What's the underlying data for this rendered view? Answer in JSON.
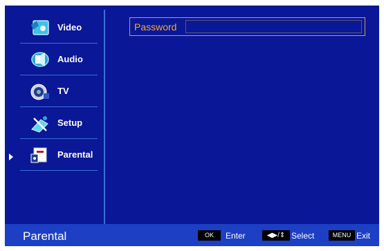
{
  "sidebar": {
    "items": [
      {
        "label": "Video",
        "icon": "video-icon"
      },
      {
        "label": "Audio",
        "icon": "audio-icon"
      },
      {
        "label": "TV",
        "icon": "tv-icon"
      },
      {
        "label": "Setup",
        "icon": "setup-icon"
      },
      {
        "label": "Parental",
        "icon": "parental-icon",
        "selected": true
      }
    ]
  },
  "main": {
    "password_label": "Password",
    "password_value": ""
  },
  "footer": {
    "title": "Parental",
    "hints": [
      {
        "key": "OK",
        "label": "Enter"
      },
      {
        "key": "◀▶/⇕",
        "label": "Select"
      },
      {
        "key": "MENU",
        "label": "Exit"
      }
    ]
  },
  "colors": {
    "background": "#0a1796",
    "footer": "#1d3fc4",
    "divider": "#3c6fd6",
    "highlight": "#f0a830"
  }
}
